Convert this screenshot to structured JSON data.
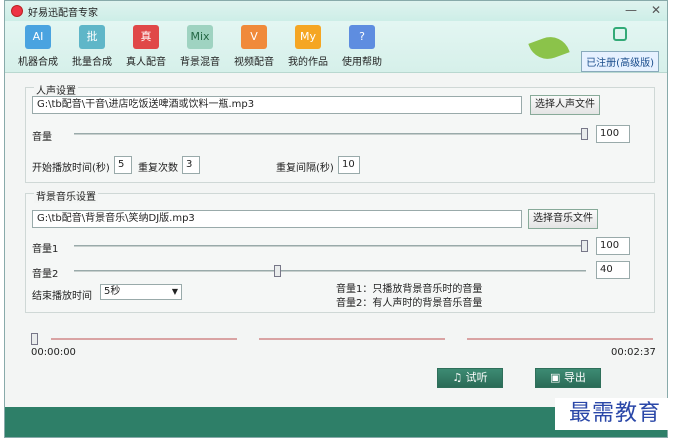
{
  "window": {
    "title": "好易迅配音专家"
  },
  "toolbar": {
    "items": [
      {
        "icon": "AI",
        "label": "机器合成",
        "color": "#4aa3e0"
      },
      {
        "icon": "批",
        "label": "批量合成",
        "color": "#5fb6c8"
      },
      {
        "icon": "真",
        "label": "真人配音",
        "color": "#e04848"
      },
      {
        "icon": "Mix",
        "label": "背景混音",
        "color": "#9fd3c1"
      },
      {
        "icon": "V",
        "label": "视频配音",
        "color": "#f08a3a"
      },
      {
        "icon": "My",
        "label": "我的作品",
        "color": "#f5a623"
      },
      {
        "icon": "?",
        "label": "使用帮助",
        "color": "#5e8de0"
      }
    ],
    "registered": "已注册(高级版)"
  },
  "voice": {
    "group_title": "人声设置",
    "path": "G:\\tb配音\\干音\\进店吃饭送啤酒或饮料一瓶.mp3",
    "choose_label": "选择人声文件",
    "volume_label": "音量",
    "volume_value": "100",
    "start_label": "开始播放时间(秒)",
    "start_value": "5",
    "repeat_label": "重复次数",
    "repeat_value": "3",
    "interval_label": "重复间隔(秒)",
    "interval_value": "10"
  },
  "bgm": {
    "group_title": "背景音乐设置",
    "path": "G:\\tb配音\\背景音乐\\笑纳DJ版.mp3",
    "choose_label": "选择音乐文件",
    "vol1_label": "音量1",
    "vol1_value": "100",
    "vol2_label": "音量2",
    "vol2_value": "40",
    "end_label": "结束播放时间",
    "end_value": "5秒",
    "note1": "音量1：只播放背景音乐时的音量",
    "note2": "音量2：有人声时的背景音乐音量"
  },
  "timeline": {
    "start": "00:00:00",
    "end": "00:02:37"
  },
  "actions": {
    "preview": "试听",
    "export": "导出"
  },
  "watermark": "最需教育"
}
